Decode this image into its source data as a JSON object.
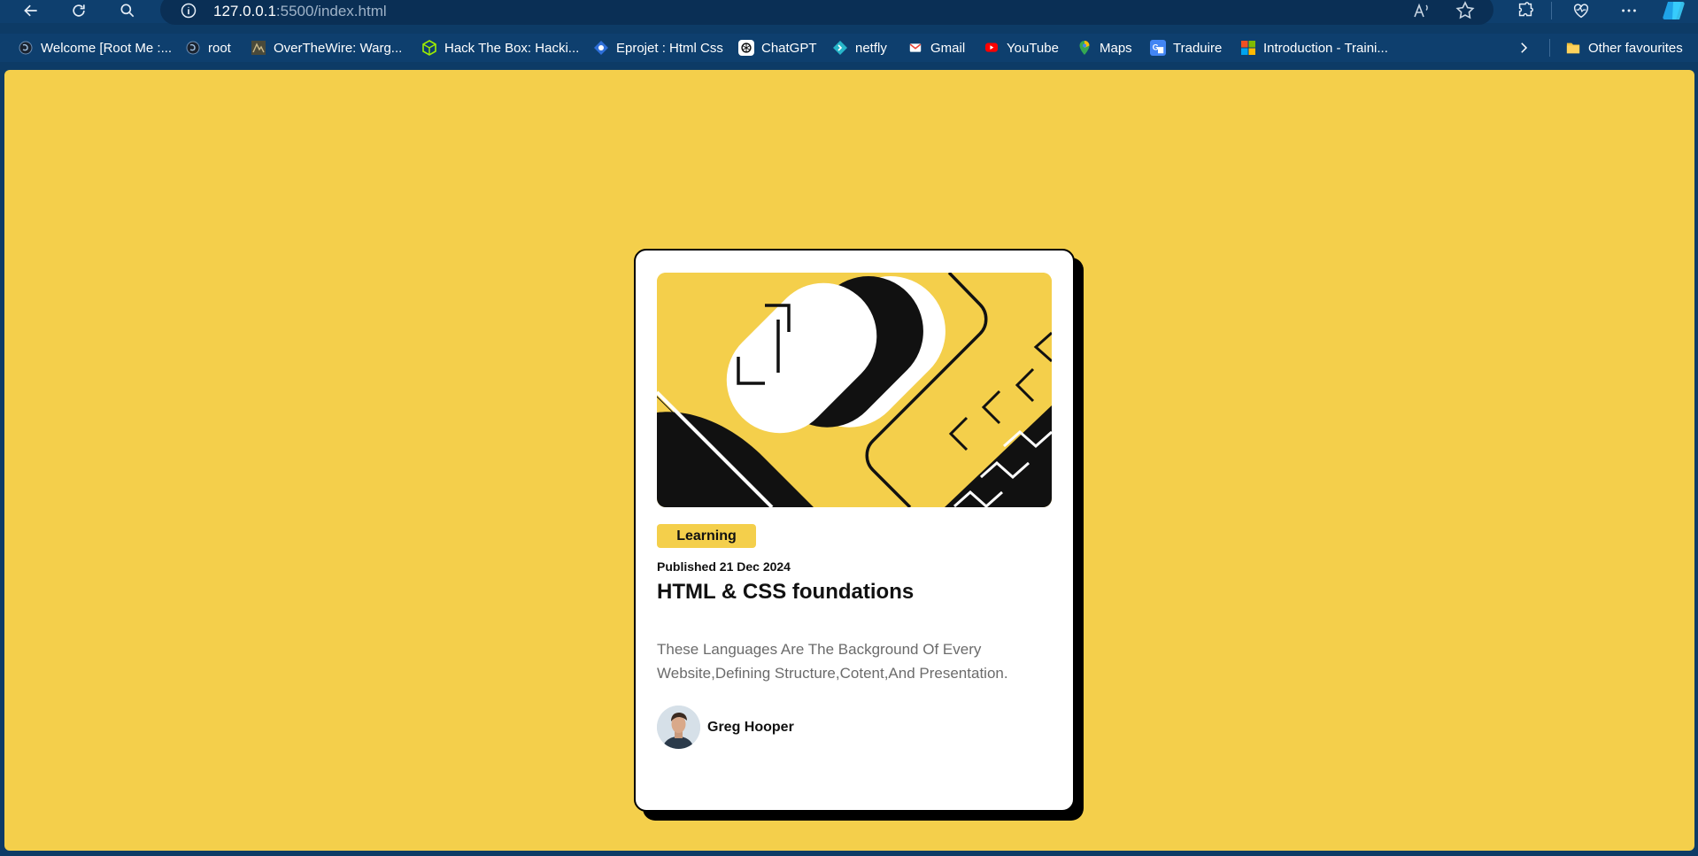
{
  "browser": {
    "url_host": "127.0.0.1",
    "url_rest": ":5500/index.html"
  },
  "bookmarks": [
    {
      "label": "Welcome [Root Me :...",
      "icon": "rootme-icon"
    },
    {
      "label": "root",
      "icon": "rootme-icon"
    },
    {
      "label": "OverTheWire: Warg...",
      "icon": "overthewire-icon"
    },
    {
      "label": "Hack The Box: Hacki...",
      "icon": "hackthebox-icon"
    },
    {
      "label": "Eprojet : Html Css",
      "icon": "eprojet-icon"
    },
    {
      "label": "ChatGPT",
      "icon": "chatgpt-icon"
    },
    {
      "label": "netfly",
      "icon": "netlify-icon"
    },
    {
      "label": "Gmail",
      "icon": "gmail-icon"
    },
    {
      "label": "YouTube",
      "icon": "youtube-icon"
    },
    {
      "label": "Maps",
      "icon": "maps-icon"
    },
    {
      "label": "Traduire",
      "icon": "translate-icon"
    },
    {
      "label": "Introduction - Traini...",
      "icon": "microsoft-icon"
    }
  ],
  "other_favourites": "Other favourites",
  "card": {
    "badge": "Learning",
    "published": "Published 21 Dec 2024",
    "title": "HTML & CSS foundations",
    "description": "These Languages Are The Background Of Every Website,Defining Structure,Cotent,And Presentation.",
    "author": "Greg Hooper"
  },
  "colors": {
    "page_background": "#f4cf4b",
    "card_background": "#ffffff",
    "badge_background": "#f4cf4b",
    "browser_chrome": "#0e3f6e"
  }
}
